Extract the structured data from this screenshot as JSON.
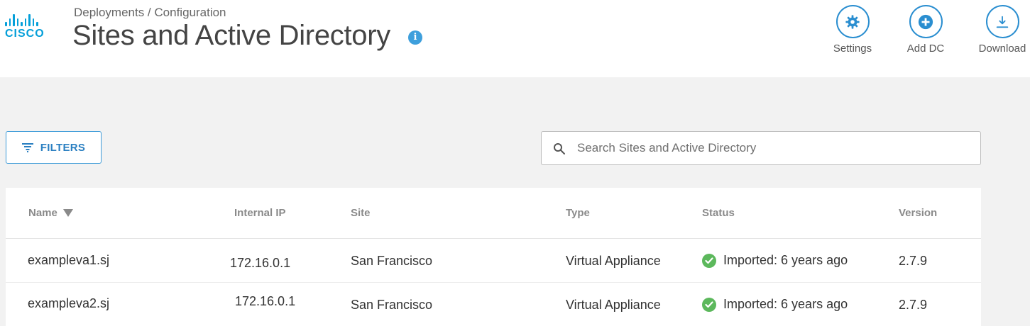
{
  "brand": {
    "name": "CISCO",
    "color": "#049fd9"
  },
  "header": {
    "breadcrumb": "Deployments / Configuration",
    "title": "Sites and Active Directory",
    "info_icon": "info-icon"
  },
  "actions": [
    {
      "label": "Settings",
      "icon": "gear-icon"
    },
    {
      "label": "Add DC",
      "icon": "plus-circle-icon"
    },
    {
      "label": "Download",
      "icon": "download-icon"
    }
  ],
  "toolbar": {
    "filters_label": "FILTERS",
    "search_placeholder": "Search Sites and Active Directory",
    "search_value": ""
  },
  "table": {
    "columns": [
      "Name",
      "Internal IP",
      "Site",
      "Type",
      "Status",
      "Version"
    ],
    "sort_column": "Name",
    "sort_direction": "descending",
    "rows": [
      {
        "name": "exampleva1.sj",
        "ip": "172.16.0.1",
        "site": "San Francisco",
        "type": "Virtual Appliance",
        "status": "Imported: 6 years ago",
        "version": "2.7.9"
      },
      {
        "name": "exampleva2.sj",
        "ip": "172.16.0.1",
        "site": "San Francisco",
        "type": "Virtual Appliance",
        "status": "Imported: 6 years ago",
        "version": "2.7.9"
      }
    ]
  },
  "colors": {
    "accent": "#2a8ed0",
    "status_ok": "#5cb85c",
    "page_bg": "#f2f2f2"
  }
}
